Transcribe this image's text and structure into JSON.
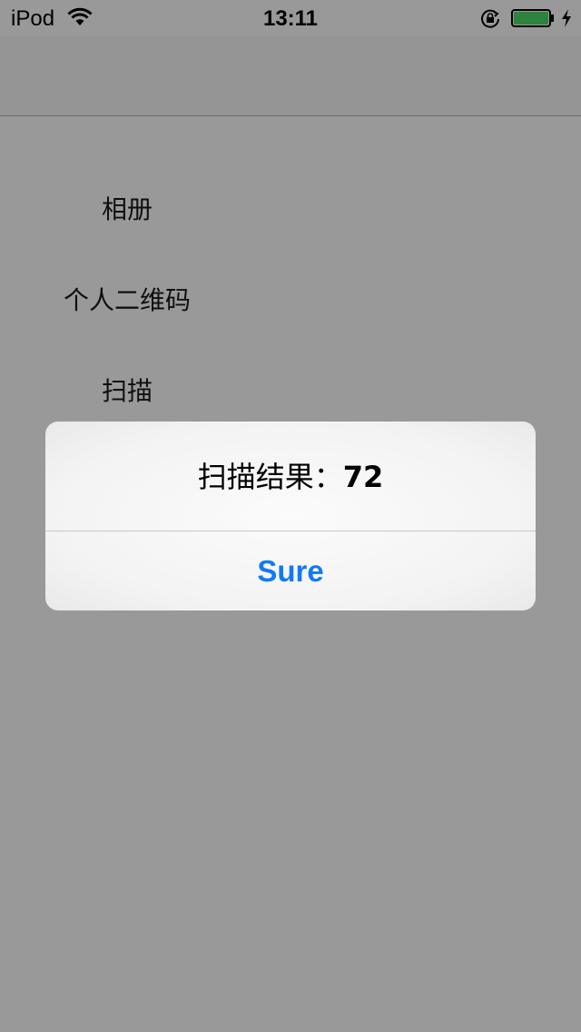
{
  "status_bar": {
    "carrier": "iPod",
    "time": "13:11",
    "wifi_icon": "wifi-icon",
    "lock_icon": "orientation-lock-icon",
    "battery_icon": "battery-icon",
    "charging_icon": "charging-bolt-icon",
    "battery_level": 1.0,
    "battery_color": "#4cd964"
  },
  "menu": {
    "items": [
      {
        "label": "相册"
      },
      {
        "label": "个人二维码"
      },
      {
        "label": "扫描"
      }
    ]
  },
  "alert": {
    "message_prefix": "扫描结果：",
    "message_value": "72",
    "button_label": "Sure",
    "button_color": "#127af6"
  }
}
